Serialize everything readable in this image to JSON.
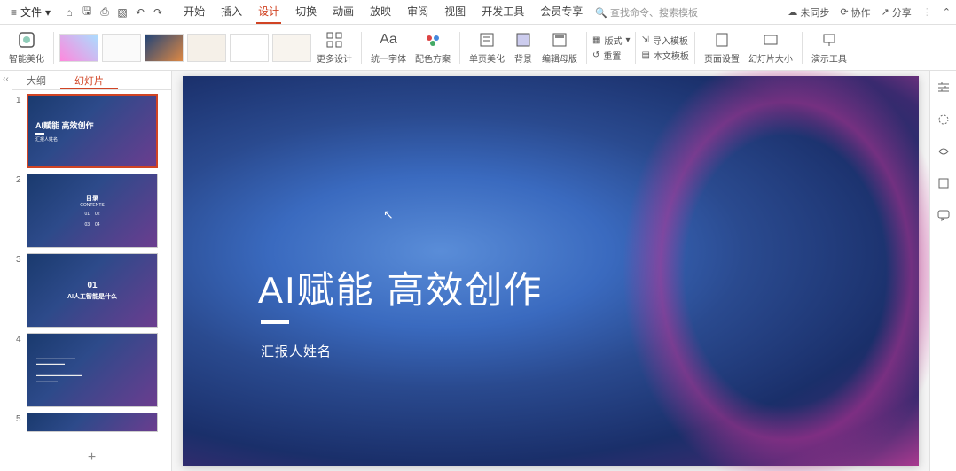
{
  "titlebar": {
    "file_label": "文件",
    "tabs": [
      "开始",
      "插入",
      "设计",
      "切换",
      "动画",
      "放映",
      "审阅",
      "视图",
      "开发工具",
      "会员专享"
    ],
    "active_tab_index": 2,
    "search_placeholder": "查找命令、搜索模板",
    "right": {
      "sync": "未同步",
      "collab": "协作",
      "share": "分享"
    }
  },
  "ribbon": {
    "beautify": "智能美化",
    "more_designs": "更多设计",
    "unify_font": "统一字体",
    "color_scheme": "配色方案",
    "page_beautify": "单页美化",
    "background": "背景",
    "edit_master": "编辑母版",
    "layout": "版式",
    "reset": "重置",
    "import_template": "导入模板",
    "local_template": "本文模板",
    "page_setup": "页面设置",
    "slide_size": "幻灯片大小",
    "present_tools": "演示工具"
  },
  "slidepanel": {
    "tab_outline": "大纲",
    "tab_slides": "幻灯片",
    "active_tab": 1,
    "slides": [
      {
        "num": "1",
        "type": "title",
        "title": "AI赋能 高效创作",
        "sub": "汇报人姓名"
      },
      {
        "num": "2",
        "type": "toc",
        "title": "目录",
        "sub": "CONTENTS",
        "items": [
          "01",
          "02",
          "03",
          "04"
        ]
      },
      {
        "num": "3",
        "type": "section",
        "num_label": "01",
        "title": "AI人工智能是什么"
      },
      {
        "num": "4",
        "type": "text"
      },
      {
        "num": "5",
        "type": "text"
      }
    ],
    "add": "+"
  },
  "canvas": {
    "title": "AI赋能 高效创作",
    "subtitle": "汇报人姓名"
  }
}
